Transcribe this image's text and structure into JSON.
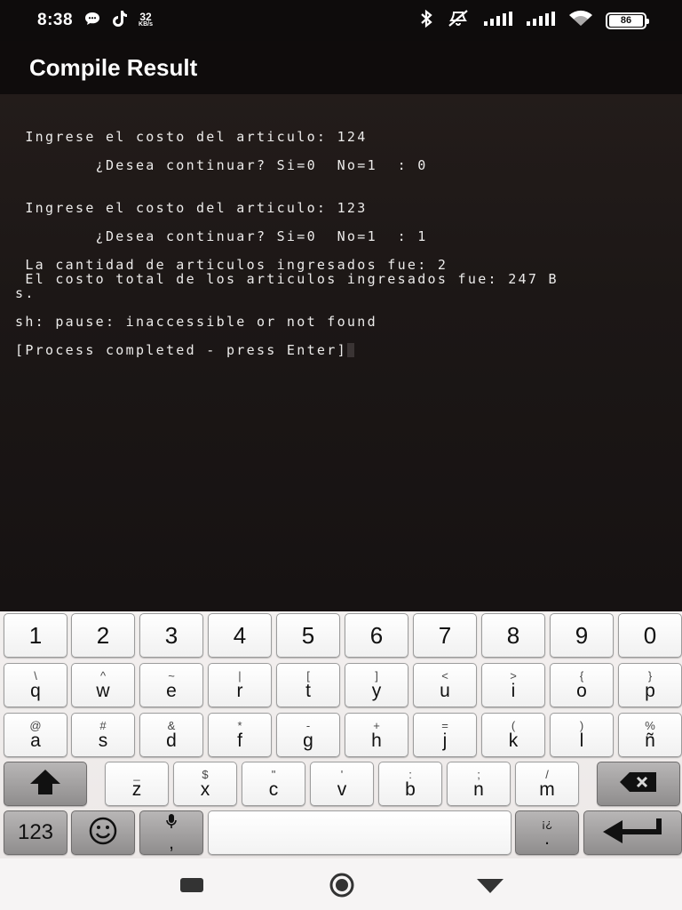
{
  "status_bar": {
    "time": "8:38",
    "net_speed_value": "32",
    "net_speed_unit": "KB/s",
    "battery": "86"
  },
  "app_bar": {
    "title": "Compile Result"
  },
  "terminal": {
    "lines": [
      " Ingrese el costo del articulo: 124",
      "",
      "        ¿Desea continuar? Si=0  No=1  : 0",
      "",
      "",
      " Ingrese el costo del articulo: 123",
      "",
      "        ¿Desea continuar? Si=0  No=1  : 1",
      "",
      " La cantidad de articulos ingresados fue: 2",
      " El costo total de los articulos ingresados fue: 247 B",
      "s.",
      "",
      "sh: pause: inaccessible or not found",
      "",
      "[Process completed - press Enter]"
    ]
  },
  "keyboard": {
    "number_row": [
      "1",
      "2",
      "3",
      "4",
      "5",
      "6",
      "7",
      "8",
      "9",
      "0"
    ],
    "row1": [
      {
        "main": "q",
        "sub": "\\"
      },
      {
        "main": "w",
        "sub": "^"
      },
      {
        "main": "e",
        "sub": "~"
      },
      {
        "main": "r",
        "sub": "|"
      },
      {
        "main": "t",
        "sub": "["
      },
      {
        "main": "y",
        "sub": "]"
      },
      {
        "main": "u",
        "sub": "<"
      },
      {
        "main": "i",
        "sub": ">"
      },
      {
        "main": "o",
        "sub": "{"
      },
      {
        "main": "p",
        "sub": "}"
      }
    ],
    "row2": [
      {
        "main": "a",
        "sub": "@"
      },
      {
        "main": "s",
        "sub": "#"
      },
      {
        "main": "d",
        "sub": "&"
      },
      {
        "main": "f",
        "sub": "*"
      },
      {
        "main": "g",
        "sub": "-"
      },
      {
        "main": "h",
        "sub": "+"
      },
      {
        "main": "j",
        "sub": "="
      },
      {
        "main": "k",
        "sub": "("
      },
      {
        "main": "l",
        "sub": ")"
      },
      {
        "main": "ñ",
        "sub": "%"
      }
    ],
    "row3": [
      {
        "main": "z",
        "sub": "_"
      },
      {
        "main": "x",
        "sub": "$"
      },
      {
        "main": "c",
        "sub": "\""
      },
      {
        "main": "v",
        "sub": "'"
      },
      {
        "main": "b",
        "sub": ":"
      },
      {
        "main": "n",
        "sub": ";"
      },
      {
        "main": "m",
        "sub": "/"
      }
    ],
    "symbols_key": "123",
    "voice_key_sub": ",",
    "punct_key_top": "¡¿",
    "punct_key_main": "."
  },
  "colors": {
    "terminal_bg": "#1b1716",
    "terminal_text": "#ecebea",
    "key_bg": "#ffffff",
    "key_dark_bg": "#9e9c9c"
  }
}
